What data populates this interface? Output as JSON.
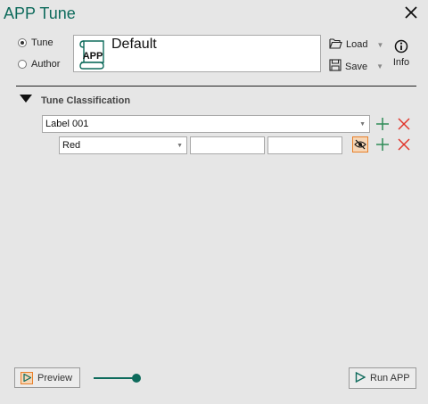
{
  "window": {
    "title": "APP Tune"
  },
  "mode": {
    "options": [
      {
        "label": "Tune",
        "selected": true
      },
      {
        "label": "Author",
        "selected": false
      }
    ]
  },
  "tune_card": {
    "icon_text": "APP",
    "name": "Default"
  },
  "toolbar": {
    "load_label": "Load",
    "save_label": "Save",
    "info_label": "Info"
  },
  "section": {
    "title": "Tune Classification",
    "expanded": true
  },
  "classification": {
    "label_select": "Label 001",
    "condition": {
      "select": "Red",
      "field_1": "",
      "field_2": ""
    }
  },
  "footer": {
    "preview_label": "Preview",
    "run_label": "Run APP",
    "slider_level": 1.0
  },
  "colors": {
    "accent": "#0e6b5c",
    "delete": "#e0352b",
    "add": "#2e8b57",
    "highlight": "#e8802a"
  },
  "icons": [
    "close-icon",
    "folder-open-icon",
    "save-disk-icon",
    "info-icon",
    "triangle-down-icon",
    "plus-icon",
    "delete-x-icon",
    "visibility-icon",
    "play-icon",
    "scroll-icon"
  ]
}
